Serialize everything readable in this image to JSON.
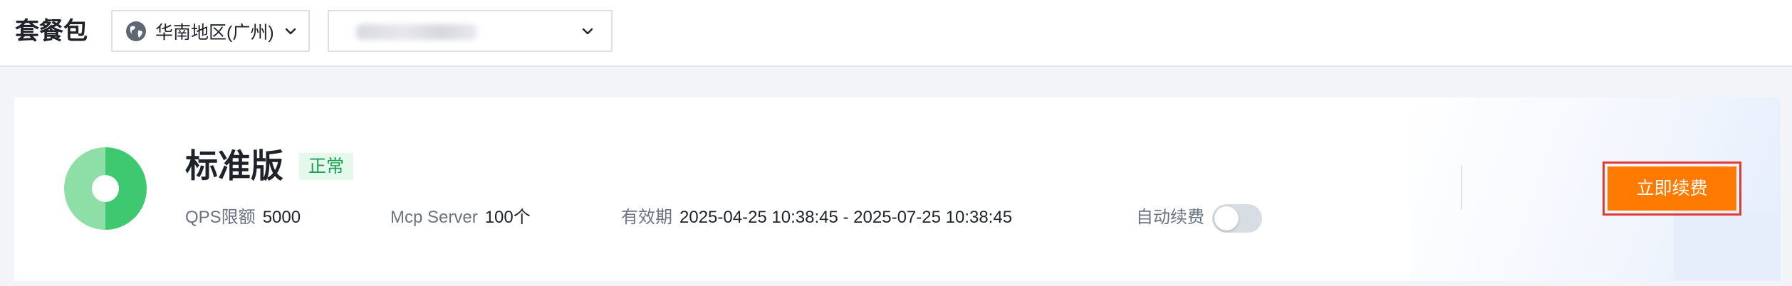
{
  "header": {
    "title": "套餐包",
    "region": {
      "icon": "globe-icon",
      "selected": "华南地区(广州)",
      "dropdown_icon": "chevron-down-icon"
    },
    "instance": {
      "selected": "",
      "dropdown_icon": "chevron-down-icon"
    }
  },
  "plan": {
    "icon": "donut-chart-icon",
    "name": "标准版",
    "status": "正常",
    "status_color": "#1aa355",
    "qps_label": "QPS限额",
    "qps_value": "5000",
    "mcp_label": "Mcp Server",
    "mcp_value": "100个",
    "validity_label": "有效期",
    "validity_value": "2025-04-25 10:38:45 - 2025-07-25 10:38:45",
    "auto_renew_label": "自动续费",
    "auto_renew_on": false,
    "renew_button": "立即续费",
    "accent_color": "#ff7a00"
  }
}
